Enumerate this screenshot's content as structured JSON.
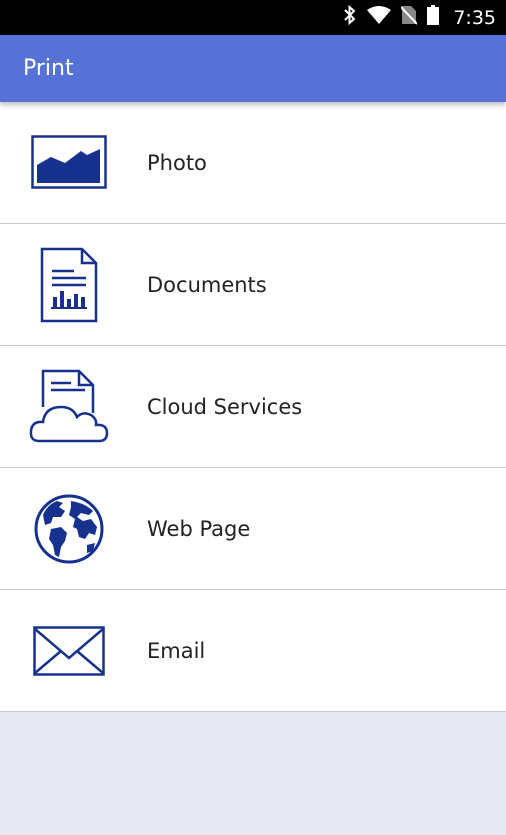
{
  "status_bar": {
    "time": "7:35",
    "icons": [
      "bluetooth-icon",
      "wifi-icon",
      "no-sim-icon",
      "battery-icon"
    ]
  },
  "app_bar": {
    "title": "Print",
    "color": "#5672d6"
  },
  "menu": {
    "items": [
      {
        "label": "Photo",
        "icon": "photo-icon"
      },
      {
        "label": "Documents",
        "icon": "document-icon"
      },
      {
        "label": "Cloud Services",
        "icon": "cloud-services-icon"
      },
      {
        "label": "Web Page",
        "icon": "globe-icon"
      },
      {
        "label": "Email",
        "icon": "envelope-icon"
      }
    ]
  },
  "colors": {
    "icon": "#17318f",
    "background": "#e6e9f4",
    "list_background": "#ffffff"
  }
}
